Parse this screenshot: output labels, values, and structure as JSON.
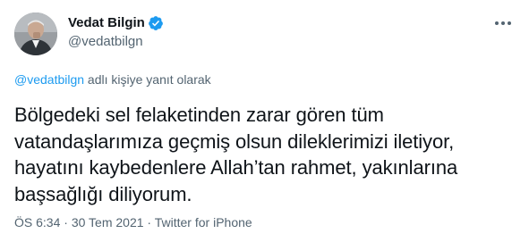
{
  "author": {
    "display_name": "Vedat Bilgin",
    "username": "@vedatbilgn",
    "verified": true
  },
  "reply": {
    "handle": "@vedatbilgn",
    "suffix": " adlı kişiye yanıt olarak"
  },
  "tweet": {
    "lines": [
      "Bölgedeki sel felaketinden zarar gören tüm",
      "vatandaşlarımıza geçmiş olsun dileklerimizi iletiyor,",
      "hayatını kaybedenlere Allah’tan rahmet, yakınlarına",
      "başsağlığı diliyorum."
    ]
  },
  "meta": {
    "time": "ÖS 6:34",
    "separator": " · ",
    "date": "30 Tem 2021",
    "source": "Twitter for iPhone"
  },
  "icons": {
    "verified": "verified-badge-icon",
    "more": "more-options-icon"
  },
  "colors": {
    "accent": "#1d9bf0",
    "secondary_text": "#536471",
    "primary_text": "#0f1419"
  }
}
